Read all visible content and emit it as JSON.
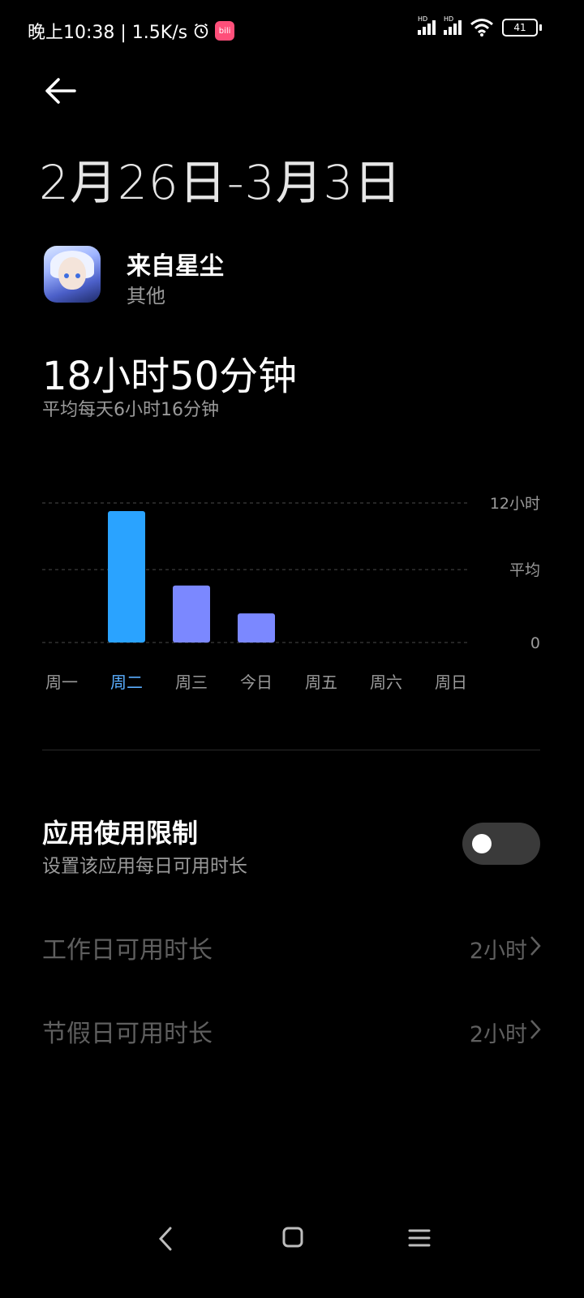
{
  "status_bar": {
    "time_network": "晚上10:38 | 1.5K/s",
    "app_badge": "bili",
    "signal_tag": "HD",
    "battery": "41"
  },
  "header": {
    "date_range": "2月26日-3月3日"
  },
  "app": {
    "name": "来自星尘",
    "category": "其他"
  },
  "usage": {
    "total": "18小时50分钟",
    "average": "平均每天6小时16分钟"
  },
  "chart_data": {
    "type": "bar",
    "categories": [
      "周一",
      "周二",
      "周三",
      "今日",
      "周五",
      "周六",
      "周日"
    ],
    "values_hours": [
      0,
      11.3,
      4.9,
      2.5,
      0,
      0,
      0
    ],
    "selected_index": 1,
    "reference_lines": [
      {
        "label": "12小时",
        "value": 12
      },
      {
        "label": "平均",
        "value": 6.27
      },
      {
        "label": "0",
        "value": 0
      }
    ],
    "ylim": [
      0,
      12
    ],
    "colors": {
      "selected": "#2aa3ff",
      "normal": "#7b88ff",
      "label": "#9a9a9a",
      "selected_label": "#5aaeff",
      "grid": "#4a4a4a"
    }
  },
  "limit": {
    "title": "应用使用限制",
    "subtitle": "设置该应用每日可用时长",
    "enabled": false
  },
  "rows": [
    {
      "label": "工作日可用时长",
      "value": "2小时"
    },
    {
      "label": "节假日可用时长",
      "value": "2小时"
    }
  ],
  "nav": {
    "back_icon": "chevron-left-icon",
    "home_icon": "square-icon",
    "menu_icon": "menu-icon"
  }
}
